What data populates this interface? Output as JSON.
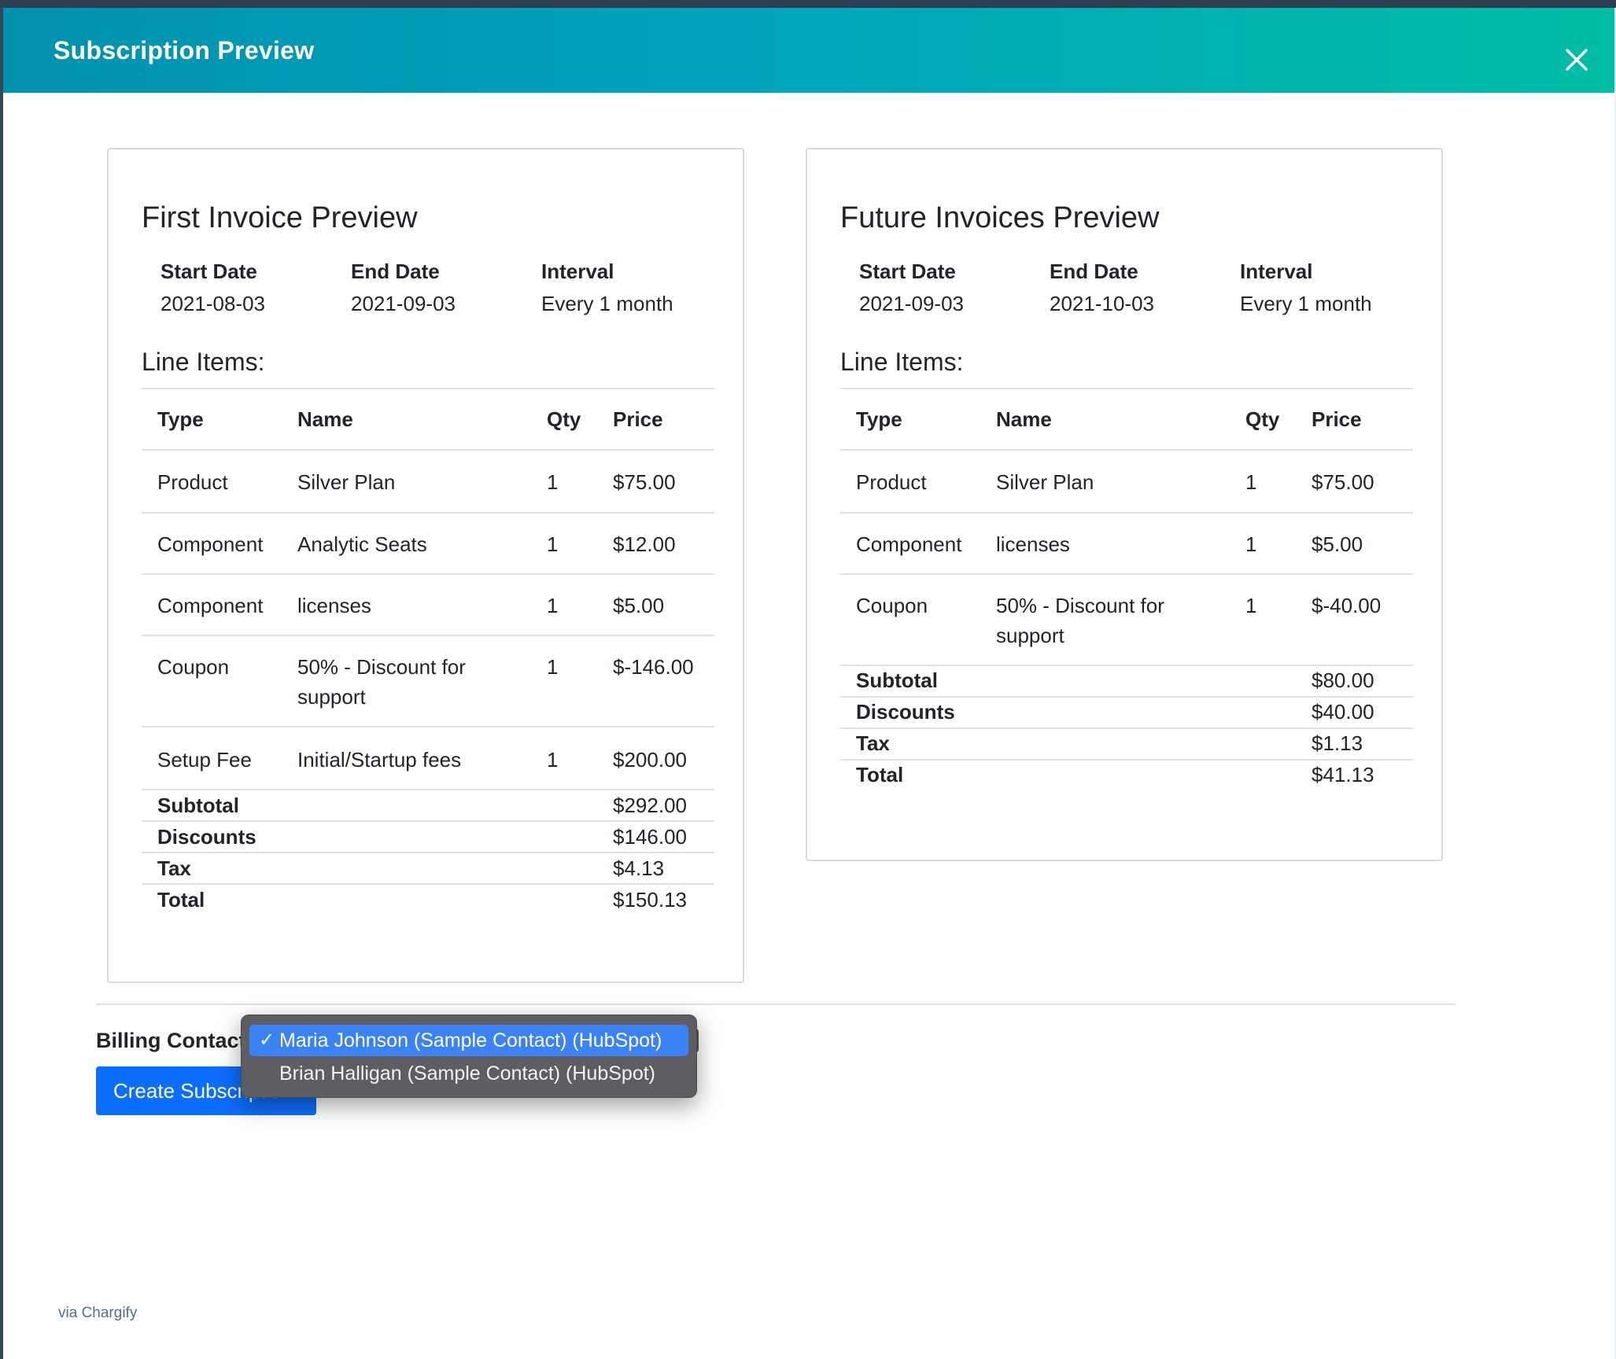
{
  "header": {
    "title": "Subscription Preview"
  },
  "first_invoice": {
    "title": "First Invoice Preview",
    "meta": [
      {
        "label": "Start Date",
        "value": "2021-08-03"
      },
      {
        "label": "End Date",
        "value": "2021-09-03"
      },
      {
        "label": "Interval",
        "value": "Every 1 month"
      }
    ],
    "line_items_label": "Line Items:",
    "columns": [
      "Type",
      "Name",
      "Qty",
      "Price"
    ],
    "rows": [
      {
        "type": "Product",
        "name": "Silver Plan",
        "qty": "1",
        "price": "$75.00"
      },
      {
        "type": "Component",
        "name": "Analytic Seats",
        "qty": "1",
        "price": "$12.00"
      },
      {
        "type": "Component",
        "name": "licenses",
        "qty": "1",
        "price": "$5.00"
      },
      {
        "type": "Coupon",
        "name_line1": "50% - Discount for",
        "name_line2": "support",
        "qty": "1",
        "price": "$-146.00"
      },
      {
        "type": "Setup Fee",
        "name": "Initial/Startup fees",
        "qty": "1",
        "price": "$200.00"
      }
    ],
    "totals": [
      {
        "label": "Subtotal",
        "value": "$292.00"
      },
      {
        "label": "Discounts",
        "value": "$146.00"
      },
      {
        "label": "Tax",
        "value": "$4.13"
      },
      {
        "label": "Total",
        "value": "$150.13"
      }
    ]
  },
  "future_invoices": {
    "title": "Future Invoices Preview",
    "meta": [
      {
        "label": "Start Date",
        "value": "2021-09-03"
      },
      {
        "label": "End Date",
        "value": "2021-10-03"
      },
      {
        "label": "Interval",
        "value": "Every 1 month"
      }
    ],
    "line_items_label": "Line Items:",
    "columns": [
      "Type",
      "Name",
      "Qty",
      "Price"
    ],
    "rows": [
      {
        "type": "Product",
        "name": "Silver Plan",
        "qty": "1",
        "price": "$75.00"
      },
      {
        "type": "Component",
        "name": "licenses",
        "qty": "1",
        "price": "$5.00"
      },
      {
        "type": "Coupon",
        "name_line1": "50% - Discount for",
        "name_line2": "support",
        "qty": "1",
        "price": "$-40.00"
      }
    ],
    "totals": [
      {
        "label": "Subtotal",
        "value": "$80.00"
      },
      {
        "label": "Discounts",
        "value": "$40.00"
      },
      {
        "label": "Tax",
        "value": "$1.13"
      },
      {
        "label": "Total",
        "value": "$41.13"
      }
    ]
  },
  "billing": {
    "label": "Billing Contact",
    "options": [
      {
        "label": "Maria Johnson (Sample Contact) (HubSpot)",
        "selected": true
      },
      {
        "label": "Brian Halligan (Sample Contact) (HubSpot)",
        "selected": false
      }
    ],
    "checkmark": "✓"
  },
  "create_button": {
    "label": "Create Subscription"
  },
  "footer": {
    "text": "via Chargify"
  },
  "colors": {
    "header_gradient_start": "#0091ae",
    "header_gradient_end": "#00bda5",
    "primary_button": "#0d6efd",
    "selected_option": "#3b82f6"
  }
}
